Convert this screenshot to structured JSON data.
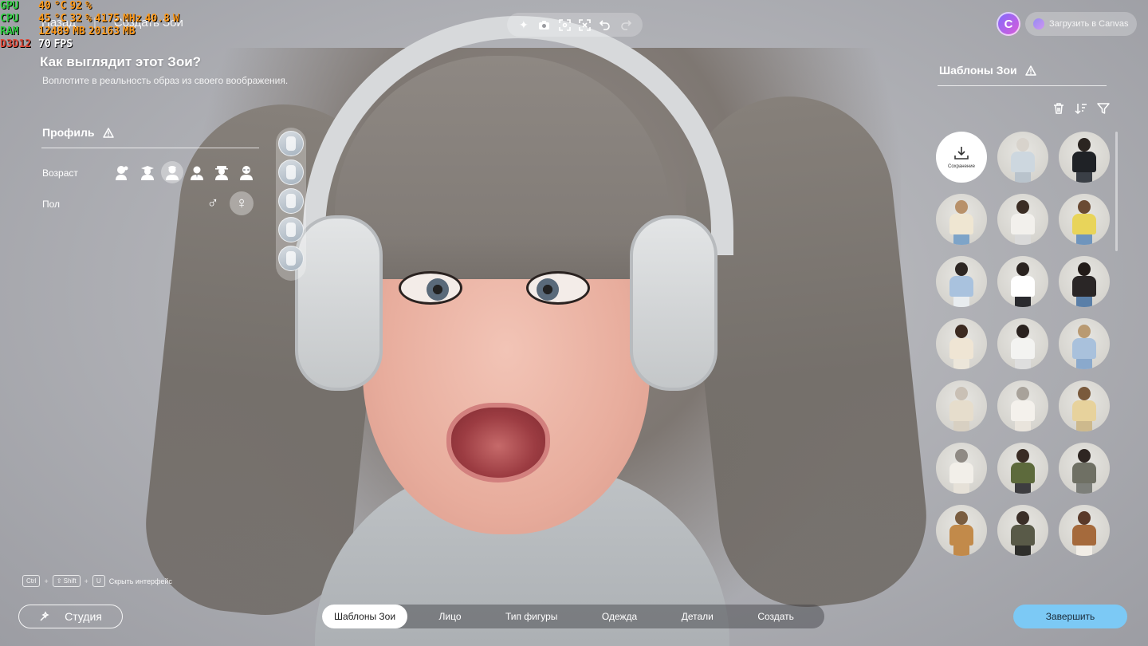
{
  "overlay": {
    "gpu": {
      "label": "GPU",
      "temp": "40",
      "temp_unit": "°C",
      "load": "92",
      "load_unit": "%"
    },
    "cpu": {
      "label": "CPU",
      "temp": "45",
      "temp_unit": "°C",
      "load": "32",
      "load_unit": "%",
      "clock": "4175",
      "clock_unit": "MHz",
      "power": "40.8",
      "power_unit": "W"
    },
    "ram": {
      "label": "RAM",
      "used": "12489",
      "used_unit": "MB",
      "total": "20163",
      "total_unit": "MB"
    },
    "api": {
      "label": "D3D12",
      "fps": "70",
      "fps_unit": "FPS"
    }
  },
  "nav": {
    "back": "Назад",
    "separator": "|",
    "current": "Создать Зои"
  },
  "toolbar": {
    "icons": [
      "sparkle-icon",
      "camera-icon",
      "focus-icon",
      "face-scan-icon",
      "undo-icon",
      "redo-icon"
    ]
  },
  "canvas": {
    "logo_letter": "C",
    "upload_label": "Загрузить в Canvas"
  },
  "intro": {
    "title": "Как выглядит этот Зои?",
    "subtitle": "Воплотите в реальность образ из своего воображения."
  },
  "profile": {
    "title": "Профиль",
    "age_label": "Возраст",
    "sex_label": "Пол",
    "age_selected_index": 2,
    "sex_options": [
      "♂",
      "♀"
    ],
    "sex_selected_index": 1
  },
  "templates": {
    "title": "Шаблоны Зои",
    "save_label": "Сохранение",
    "items": [
      {
        "hair": "#d8d3cc",
        "top": "#cdd7df",
        "bottom": "#b9c3cc"
      },
      {
        "hair": "#2b2521",
        "top": "#1f2226",
        "bottom": "#3a3f46"
      },
      {
        "hair": "#b8916a",
        "top": "#efe6d2",
        "bottom": "#7ea4c8"
      },
      {
        "hair": "#3b2d24",
        "top": "#f2f0ec",
        "bottom": "#d9d9d9"
      },
      {
        "hair": "#6a4a33",
        "top": "#e8d45a",
        "bottom": "#6f95bd"
      },
      {
        "hair": "#2d2622",
        "top": "#a9c2de",
        "bottom": "#e8ecef"
      },
      {
        "hair": "#2a2320",
        "top": "#ffffff",
        "bottom": "#2a2a2e"
      },
      {
        "hair": "#221b18",
        "top": "#2a2626",
        "bottom": "#5a7fa8"
      },
      {
        "hair": "#3c2a20",
        "top": "#efe5d4",
        "bottom": "#ece6da"
      },
      {
        "hair": "#2a221f",
        "top": "#f3f3f1",
        "bottom": "#dedede"
      },
      {
        "hair": "#b99a72",
        "top": "#a9c1dc",
        "bottom": "#8aa9cc"
      },
      {
        "hair": "#c9c0b5",
        "top": "#e6ddcc",
        "bottom": "#d8d0c2"
      },
      {
        "hair": "#a8a29a",
        "top": "#f4f1ec",
        "bottom": "#e9e4dc"
      },
      {
        "hair": "#7a5a3c",
        "top": "#e7d29c",
        "bottom": "#cdb98d"
      },
      {
        "hair": "#8f8a84",
        "top": "#f2efe9",
        "bottom": "#e6e1d8"
      },
      {
        "hair": "#3a2c24",
        "top": "#5d6a3c",
        "bottom": "#3d3d40"
      },
      {
        "hair": "#2e2622",
        "top": "#6f7064",
        "bottom": "#7d7f7a"
      },
      {
        "hair": "#7a5d40",
        "top": "#c28a4a",
        "bottom": "#c28a4a"
      },
      {
        "hair": "#3b2f28",
        "top": "#595a48",
        "bottom": "#2f2f2c"
      },
      {
        "hair": "#5a3a2a",
        "top": "#a56a3c",
        "bottom": "#f1ede6"
      }
    ]
  },
  "shortcut": {
    "key1": "Ctrl",
    "key2": "⇧ Shift",
    "key3": "U",
    "plus": "+",
    "label": "Скрыть интерфейс"
  },
  "studio_label": "Студия",
  "tabs": [
    "Шаблоны Зои",
    "Лицо",
    "Тип фигуры",
    "Одежда",
    "Детали",
    "Создать"
  ],
  "active_tab_index": 0,
  "finish_label": "Завершить"
}
